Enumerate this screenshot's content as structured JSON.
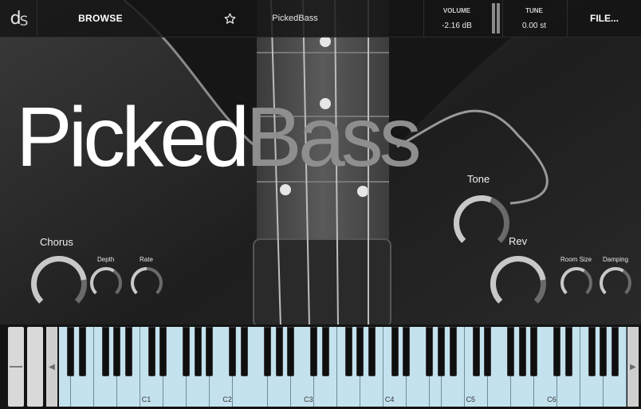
{
  "header": {
    "logo_d": "d",
    "logo_s": "S",
    "browse_label": "BROWSE",
    "preset_name": "PickedBass",
    "volume_label": "VOLUME",
    "volume_value": "-2.16 dB",
    "tune_label": "TUNE",
    "tune_value": "0.00 st",
    "file_label": "FILE..."
  },
  "title": {
    "part1": "Picked",
    "part2": "Bass"
  },
  "controls": {
    "chorus": {
      "label": "Chorus",
      "amount": 0.8
    },
    "depth": {
      "label": "Depth",
      "amount": 0.62
    },
    "rate": {
      "label": "Rate",
      "amount": 0.5
    },
    "tone": {
      "label": "Tone",
      "amount": 0.58
    },
    "rev": {
      "label": "Rev",
      "amount": 0.8
    },
    "room_size": {
      "label": "Room Size",
      "amount": 0.62
    },
    "damping": {
      "label": "Damping",
      "amount": 0.62
    }
  },
  "keyboard": {
    "white_key_count": 49,
    "octave_labels": [
      "C1",
      "C2",
      "C3",
      "C4",
      "C5",
      "C6"
    ],
    "key_color": "#c4e1ee"
  },
  "colors": {
    "knob_track": "#6a6a6a",
    "knob_value": "#c8c8c8",
    "title_primary": "#ffffff",
    "title_secondary": "#8e8e8e"
  }
}
